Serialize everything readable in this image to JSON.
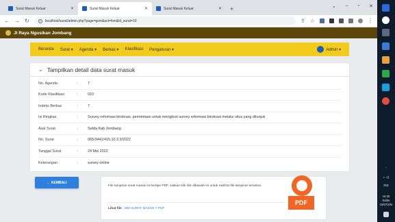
{
  "browser": {
    "tabs": [
      {
        "label": "Surat Masuk Keluar",
        "active": false
      },
      {
        "label": "Surat Masuk Keluar",
        "active": true
      },
      {
        "label": "Surat Masuk Keluar",
        "active": false
      }
    ],
    "url": "localhost/surat/admin.php?page=gsm&act=fsm&id_surat=10"
  },
  "app": {
    "title": "JI Raya Ngusikan Jombang"
  },
  "nav": {
    "items": [
      "Beranda",
      "Surat ▾",
      "Agenda ▾",
      "Berkas ▾",
      "Klasifikasi",
      "Pengaturan ▾"
    ],
    "user": "Admin ▾"
  },
  "detail": {
    "heading": "Tampilkan detail data surat masuk",
    "separator": ":",
    "rows": [
      {
        "label": "No. Agenda",
        "value": "7"
      },
      {
        "label": "Kode Klasifikasi",
        "value": "010"
      },
      {
        "label": "Indeks Berkas",
        "value": "7"
      },
      {
        "label": "Isi Ringkas",
        "value": "Survey reformasi birokrasi, permintaan untuk mengikuti survey reformasi birokrasi melalui situs yang ditunjuk"
      },
      {
        "label": "Asal Surat",
        "value": "Setda Kab Jombang"
      },
      {
        "label": "No. Surat",
        "value": "065/3441/415.10.3.3/2022"
      },
      {
        "label": "Tanggal Surat",
        "value": "24 Mei 2022"
      },
      {
        "label": "Keterangan",
        "value": "survey online"
      }
    ]
  },
  "buttons": {
    "back": "← KEMBALI"
  },
  "attachment": {
    "message": "File lampiran surat masuk ini bertipe PDF, silakan klik link dibawah ini untuk melihat file lampiran tersebut.",
    "link_prefix": "Lihat file :",
    "link_text": "898 SURAT MASUK 7.PDF",
    "pdf_label": "PDF"
  },
  "taskbar": {
    "time": "16.25",
    "day": "Sabtu",
    "date": "23/07/202",
    "lang": "IND"
  },
  "colors": {
    "header": "#5a4608",
    "navbar": "#f3cb1b",
    "primary": "#2f7fe0",
    "pdf": "#f26522"
  }
}
